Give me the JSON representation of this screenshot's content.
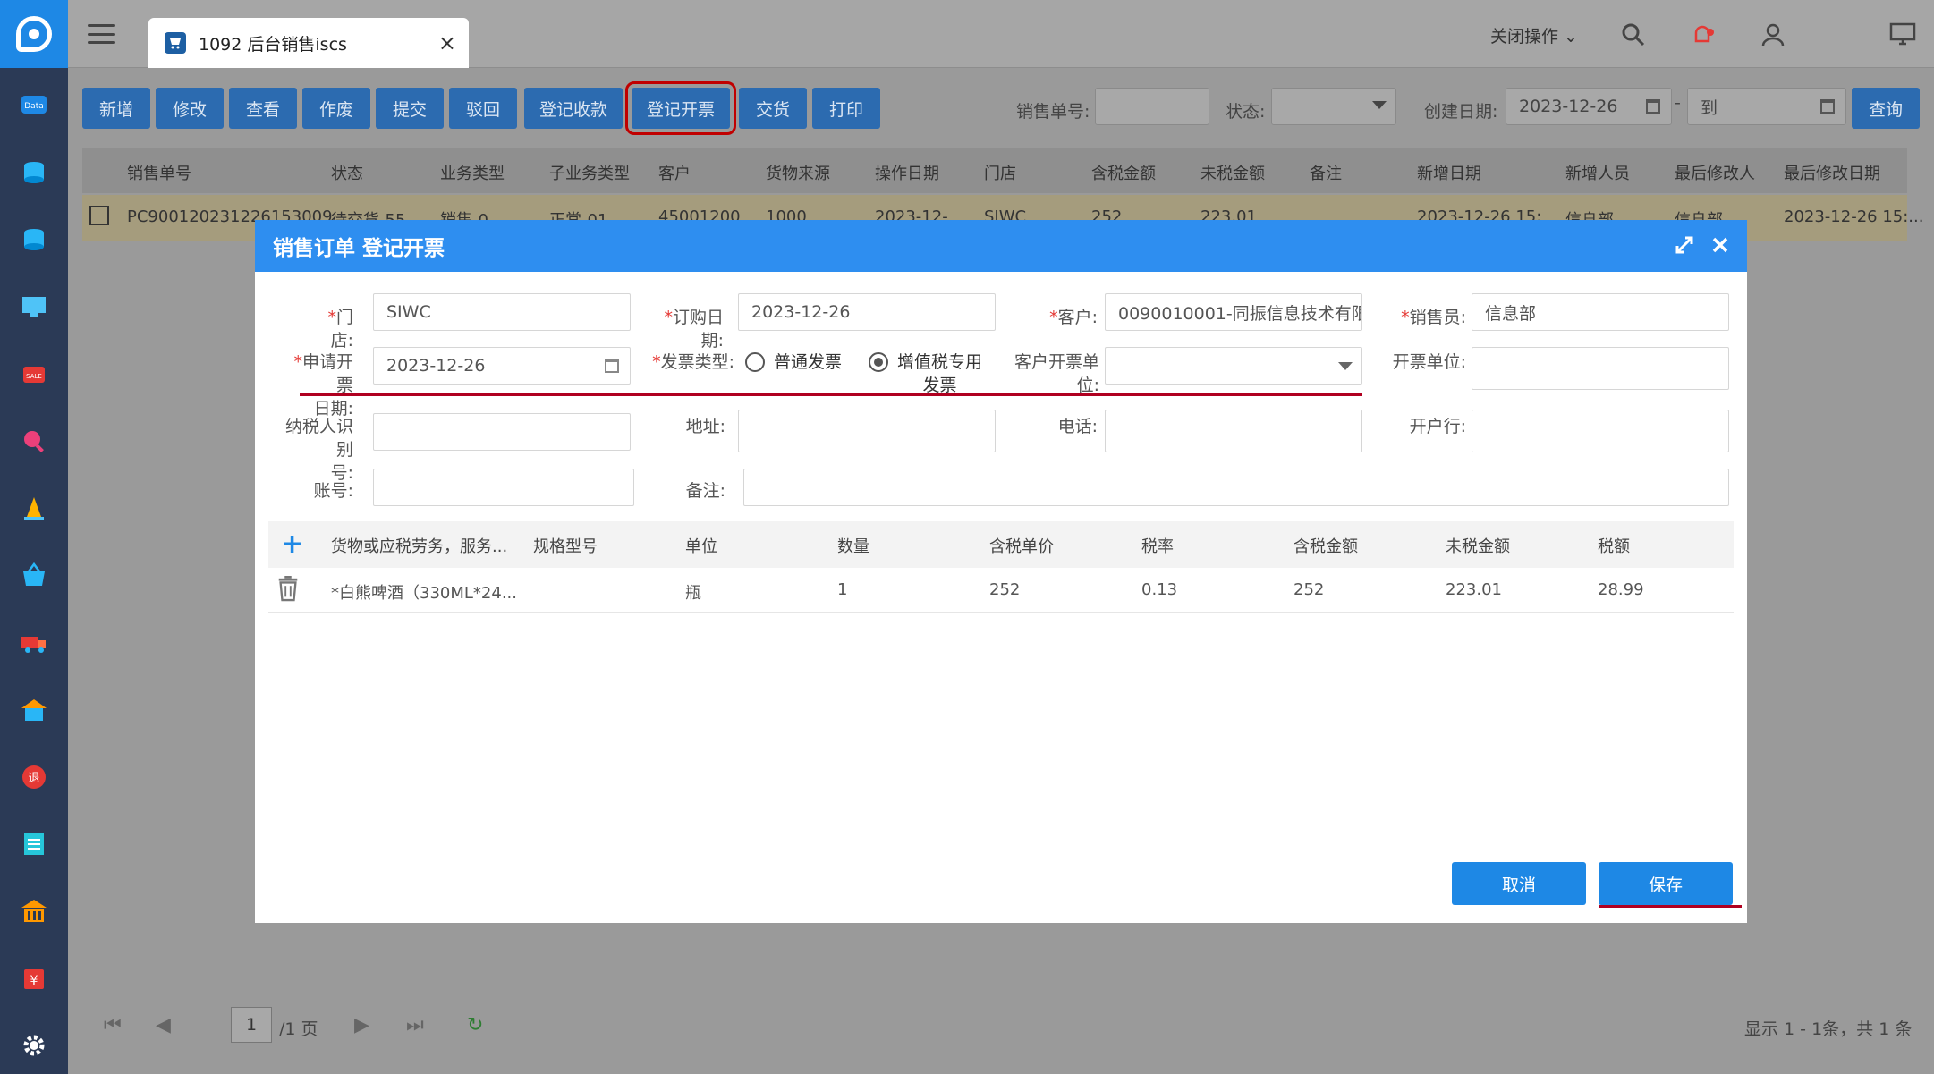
{
  "header": {
    "tab_title": "1092 后台销售iscs",
    "tab_close": "×",
    "close_ops": "关闭操作 ⌄"
  },
  "toolbar": {
    "buttons": [
      "新增",
      "修改",
      "查看",
      "作废",
      "提交",
      "驳回",
      "登记收款",
      "登记开票",
      "交货",
      "打印"
    ],
    "highlighted_button": "登记开票",
    "order_no_label": "销售单号:",
    "order_no_value": "",
    "status_label": "状态:",
    "status_value": "",
    "create_date_label": "创建日期:",
    "date_from": "2023-12-26",
    "date_sep": "-",
    "date_to_placeholder": "到",
    "search_button": "查询"
  },
  "grid": {
    "columns": [
      "销售单号",
      "状态",
      "业务类型",
      "子业务类型",
      "客户",
      "货物来源",
      "操作日期",
      "门店",
      "含税金额",
      "未税金额",
      "备注",
      "新增日期",
      "新增人员",
      "最后修改人",
      "最后修改日期"
    ],
    "row": [
      "PC900120231226153009",
      "待交货-55",
      "销售-0",
      "正常-01",
      "45001200",
      "1000",
      "2023-12-",
      "SIWC",
      "252",
      "223.01",
      "",
      "2023-12-26 15:",
      "信息部",
      "信息部",
      "2023-12-26 15:..."
    ]
  },
  "pager": {
    "page": "1",
    "total_pages": "/1 页",
    "summary": "显示 1 - 1条，共 1 条"
  },
  "modal": {
    "title": "销售订单 登记开票",
    "fields": {
      "store_label": "门店:",
      "store_value": "SIWC",
      "order_date_label": "订购日期:",
      "order_date_value": "2023-12-26",
      "customer_label": "客户:",
      "customer_value": "0090010001-同振信息技术有限",
      "salesman_label": "销售员:",
      "salesman_value": "信息部",
      "apply_date_label_1": "申请开票",
      "apply_date_label_2": "日期:",
      "apply_date_value": "2023-12-26",
      "invoice_type_label": "发票类型:",
      "invoice_type_opt1": "普通发票",
      "invoice_type_opt2_1": "增值税专用",
      "invoice_type_opt2_2": "发票",
      "invoice_type_selected": "增值税专用发票",
      "cust_invoice_unit_label_1": "客户开票单",
      "cust_invoice_unit_label_2": "位:",
      "cust_invoice_unit_value": "",
      "invoice_unit_label": "开票单位:",
      "invoice_unit_value": "",
      "tax_id_label_1": "纳税人识别",
      "tax_id_label_2": "号:",
      "tax_id_value": "",
      "address_label": "地址:",
      "address_value": "",
      "phone_label": "电话:",
      "phone_value": "",
      "bank_label": "开户行:",
      "bank_value": "",
      "account_label": "账号:",
      "account_value": "",
      "remark_label": "备注:",
      "remark_value": ""
    },
    "table": {
      "add_icon": "+",
      "columns": [
        "货物或应税劳务，服务...",
        "规格型号",
        "单位",
        "数量",
        "含税单价",
        "税率",
        "含税金额",
        "未税金额",
        "税额"
      ],
      "rows": [
        [
          "*白熊啤酒（330ML*24...",
          "",
          "瓶",
          "1",
          "252",
          "0.13",
          "252",
          "223.01",
          "28.99"
        ]
      ]
    },
    "cancel_button": "取消",
    "save_button": "保存"
  },
  "colors": {
    "modal_header": "#2e8ef0",
    "toolbar_button": "#2c6bb0",
    "primary_button": "#1e88e5",
    "annotation_red": "#b00020",
    "sidebar": "#2b3a56"
  }
}
